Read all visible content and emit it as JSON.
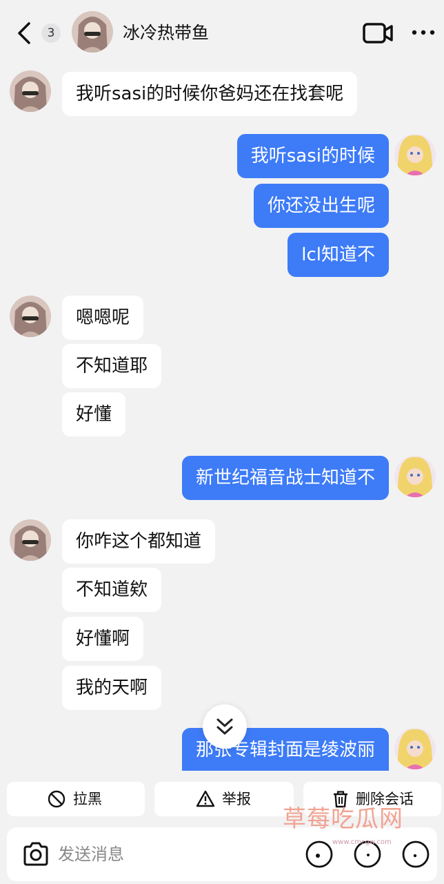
{
  "header": {
    "unread_count": "3",
    "contact_name": "冰冷热带鱼"
  },
  "messages": [
    {
      "side": "in",
      "text": "我听sasi的时候你爸妈还在找套呢"
    },
    {
      "side": "out",
      "text": "我听sasi的时候"
    },
    {
      "side": "out",
      "text": "你还没出生呢"
    },
    {
      "side": "out",
      "text": "lcl知道不"
    },
    {
      "side": "in",
      "text": "嗯嗯呢"
    },
    {
      "side": "in",
      "text": "不知道耶"
    },
    {
      "side": "in",
      "text": "好懂"
    },
    {
      "side": "out",
      "text": "新世纪福音战士知道不"
    },
    {
      "side": "in",
      "text": "你咋这个都知道"
    },
    {
      "side": "in",
      "text": "不知道欸"
    },
    {
      "side": "in",
      "text": "好懂啊"
    },
    {
      "side": "in",
      "text": "我的天啊"
    },
    {
      "side": "out",
      "text": "那张专辑封面是绫波丽"
    }
  ],
  "actions": {
    "block_label": "拉黑",
    "report_label": "举报",
    "delete_label": "删除会话"
  },
  "input": {
    "placeholder": "发送消息"
  },
  "watermark": {
    "text": "草莓吃瓜网",
    "url": "www.cmcgw.com"
  },
  "colors": {
    "outgoing_bubble": "#3d7bf7",
    "incoming_bubble": "#ffffff",
    "background": "#f2f2f3"
  },
  "icons": [
    "back-arrow-icon",
    "video-call-icon",
    "more-icon",
    "chevron-double-down-icon",
    "block-icon",
    "warning-icon",
    "trash-icon",
    "camera-icon"
  ]
}
